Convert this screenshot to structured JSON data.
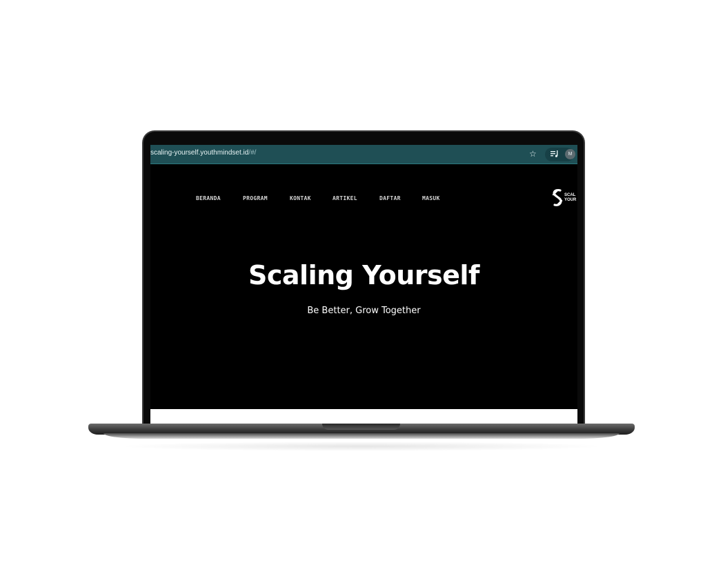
{
  "browser": {
    "url_main": "scaling-yourself.youthmindset.id",
    "url_tail": "/#/",
    "profile_initial": "M"
  },
  "nav": {
    "items": [
      "BERANDA",
      "PROGRAM",
      "KONTAK",
      "ARTIKEL",
      "DAFTAR",
      "MASUK"
    ]
  },
  "logo": {
    "text": "SCAL\nYOUR"
  },
  "hero": {
    "title": "Scaling Yourself",
    "subtitle": "Be Better, Grow Together"
  },
  "icons": {
    "bookmark": "star-icon",
    "media": "media-control-icon",
    "logo": "scaling-yourself-logo-icon"
  },
  "colors": {
    "page_background": "#000000",
    "address_bar": "#1f4f55",
    "nav_text": "#d6d6d6",
    "hero_text": "#ffffff"
  }
}
